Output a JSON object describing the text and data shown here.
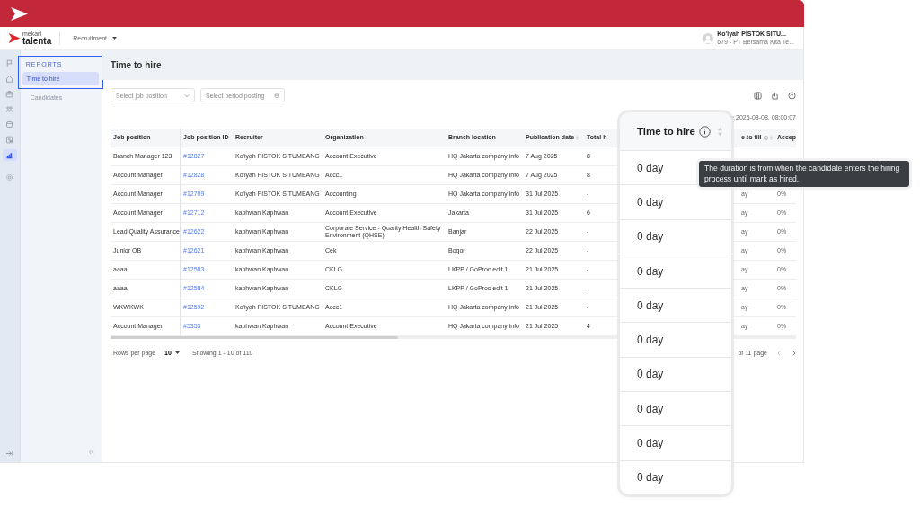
{
  "header": {
    "brand_top": "mekari",
    "brand": "talenta",
    "module": "Recruitment",
    "user_name": "Ko'iyah PISTOK SITU...",
    "user_company": "679 - PT Bersama Kita Te..."
  },
  "rail": [
    {
      "kind": "flag",
      "selected": false
    },
    {
      "kind": "home",
      "selected": false
    },
    {
      "kind": "briefcase",
      "selected": false
    },
    {
      "kind": "people",
      "selected": false
    },
    {
      "kind": "box",
      "selected": false
    },
    {
      "kind": "document",
      "selected": false
    },
    {
      "kind": "chart",
      "selected": true
    },
    {
      "kind": "gear",
      "selected": false
    }
  ],
  "sidebar": {
    "section": "REPORTS",
    "items": [
      {
        "label": "Time to hire",
        "selected": true
      },
      {
        "label": "Candidates",
        "selected": false
      }
    ]
  },
  "page_title": "Time to hire",
  "filters": [
    {
      "kind": "select",
      "placeholder": "Select job position"
    },
    {
      "kind": "date",
      "placeholder": "Select period posting"
    }
  ],
  "last_update": "te 2025-08-08, 08:00:07",
  "table": {
    "columns": [
      {
        "label": "Job position"
      },
      {
        "label": "Job position ID"
      },
      {
        "label": "Recruiter"
      },
      {
        "label": "Organization"
      },
      {
        "label": "Branch location"
      },
      {
        "label": "Publication date",
        "sortable": true
      },
      {
        "label": "Total h"
      },
      {
        "label": "e to fill",
        "info": true,
        "sortable": true
      },
      {
        "label": "Accep"
      }
    ],
    "rows": [
      {
        "cells": [
          "Branch Manager 123",
          "#12827",
          "Ko'iyah PISTOK SITUMEANG",
          "Account Executive",
          "HQ Jakarta company info",
          "7 Aug 2025",
          "8"
        ]
      },
      {
        "cells": [
          "Account Manager",
          "#12828",
          "Ko'iyah PISTOK SITUMEANG",
          "Accc1",
          "HQ Jakarta company info",
          "7 Aug 2025",
          "8"
        ]
      },
      {
        "cells": [
          "Account Manager",
          "#12709",
          "Ko'iyah PISTOK SITUMEANG",
          "Accounting",
          "HQ Jakarta company info",
          "31 Jul 2025",
          "-"
        ],
        "tail": [
          "ay",
          "0%"
        ]
      },
      {
        "cells": [
          "Account Manager",
          "#12712",
          "kaphwan Kaphwan",
          "Account Executive",
          "Jakarta",
          "31 Jul 2025",
          "6"
        ],
        "tail": [
          "ay",
          "0%"
        ]
      },
      {
        "cells": [
          "Lead Quality Assurance",
          "#12622",
          "kaphwan Kaphwan",
          "Corporate Service - Quality Health Safety Environment (QHSE)",
          "Banjar",
          "22 Jul 2025",
          "-"
        ],
        "tail": [
          "ay",
          "0%"
        ]
      },
      {
        "cells": [
          "Junior OB",
          "#12621",
          "kaphwan Kaphwan",
          "Cek",
          "Bogor",
          "22 Jul 2025",
          "-"
        ],
        "tail": [
          "ay",
          "0%"
        ]
      },
      {
        "cells": [
          "aaaa",
          "#12583",
          "kaphwan Kaphwan",
          "CKLG",
          "LKPP / GoProc edit 1",
          "21 Jul 2025",
          "-"
        ],
        "tail": [
          "ay",
          "0%"
        ]
      },
      {
        "cells": [
          "aaaa",
          "#12584",
          "kaphwan Kaphwan",
          "CKLG",
          "LKPP / GoProc edit 1",
          "21 Jul 2025",
          "-"
        ],
        "tail": [
          "ay",
          "0%"
        ]
      },
      {
        "cells": [
          "WKWKWK",
          "#12592",
          "Ko'iyah PISTOK SITUMEANG",
          "Accc1",
          "HQ Jakarta company info",
          "21 Jul 2025",
          "-"
        ],
        "tail": [
          "ay",
          "0%"
        ]
      },
      {
        "cells": [
          "Account Manager",
          "#5353",
          "kaphwan Kaphwan",
          "Account Executive",
          "HQ Jakarta company info",
          "21 Jul 2025",
          "4"
        ],
        "tail": [
          "ay",
          "0%"
        ]
      }
    ]
  },
  "pagination": {
    "rows_label": "Rows per page",
    "rows_value": "10",
    "showing": "Showing 1 - 10 of 110",
    "pages": "of 11 page"
  },
  "zoom_card": {
    "title": "Time to hire",
    "values": [
      "0 day",
      "0 day",
      "0 day",
      "0 day",
      "0 day",
      "0 day",
      "0 day",
      "0 day",
      "0 day",
      "0 day"
    ]
  },
  "tooltip": "The duration is from when the candidate enters the hiring process until mark as hired."
}
